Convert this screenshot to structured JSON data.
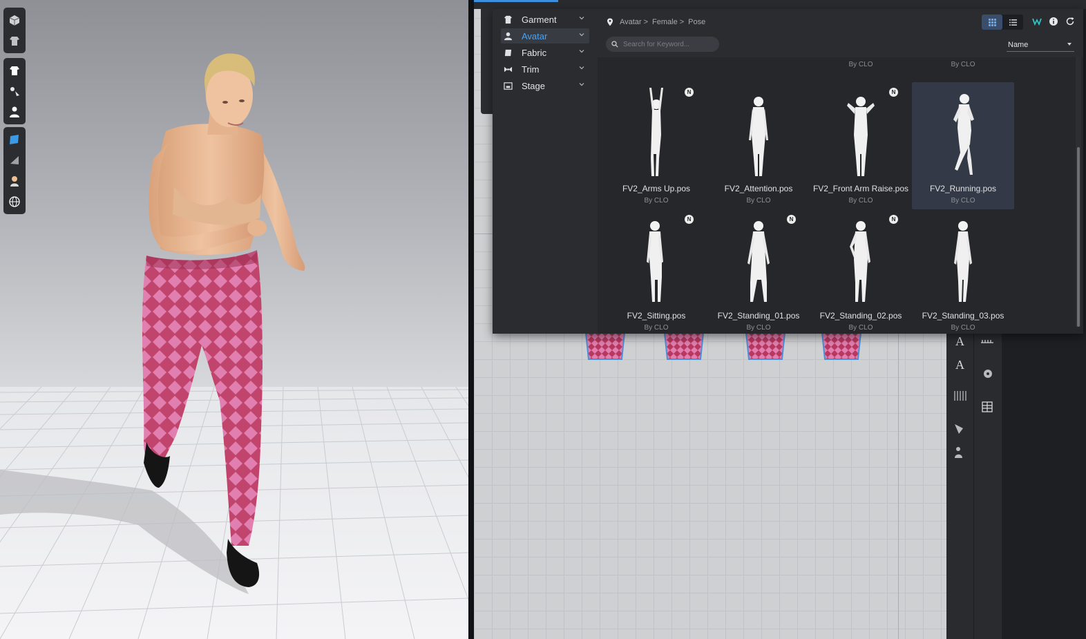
{
  "library": {
    "categories": [
      {
        "label": "Garment",
        "icon": "shirt-icon",
        "active": false
      },
      {
        "label": "Avatar",
        "icon": "avatar-icon",
        "active": true
      },
      {
        "label": "Fabric",
        "icon": "fabric-icon",
        "active": false
      },
      {
        "label": "Trim",
        "icon": "trim-icon",
        "active": false
      },
      {
        "label": "Stage",
        "icon": "stage-icon",
        "active": false
      }
    ],
    "breadcrumb": [
      "Avatar",
      "Female",
      "Pose"
    ],
    "breadcrumb_sep": ">",
    "search_placeholder": "Search for Keyword...",
    "sort_label": "Name",
    "partial_row_by": [
      "By CLO",
      "By CLO"
    ],
    "items": [
      {
        "name": "FV2_Arms Up.pos",
        "by": "By CLO",
        "new": true,
        "selected": false
      },
      {
        "name": "FV2_Attention.pos",
        "by": "By CLO",
        "new": false,
        "selected": false
      },
      {
        "name": "FV2_Front Arm Raise.pos",
        "by": "By CLO",
        "new": true,
        "selected": false
      },
      {
        "name": "FV2_Running.pos",
        "by": "By CLO",
        "new": false,
        "selected": true
      },
      {
        "name": "FV2_Sitting.pos",
        "by": "By CLO",
        "new": true,
        "selected": false
      },
      {
        "name": "FV2_Standing_01.pos",
        "by": "By CLO",
        "new": true,
        "selected": false
      },
      {
        "name": "FV2_Standing_02.pos",
        "by": "By CLO",
        "new": true,
        "selected": false
      },
      {
        "name": "FV2_Standing_03.pos",
        "by": "By CLO",
        "new": false,
        "selected": false
      }
    ],
    "new_badge": "N"
  },
  "colors": {
    "accent": "#4ca3f0",
    "panel": "#2b2c30",
    "selected": "#333946",
    "pants_base": "#c0446b",
    "pants_diamond": "#e07fb0",
    "skin": "#e8b892"
  }
}
